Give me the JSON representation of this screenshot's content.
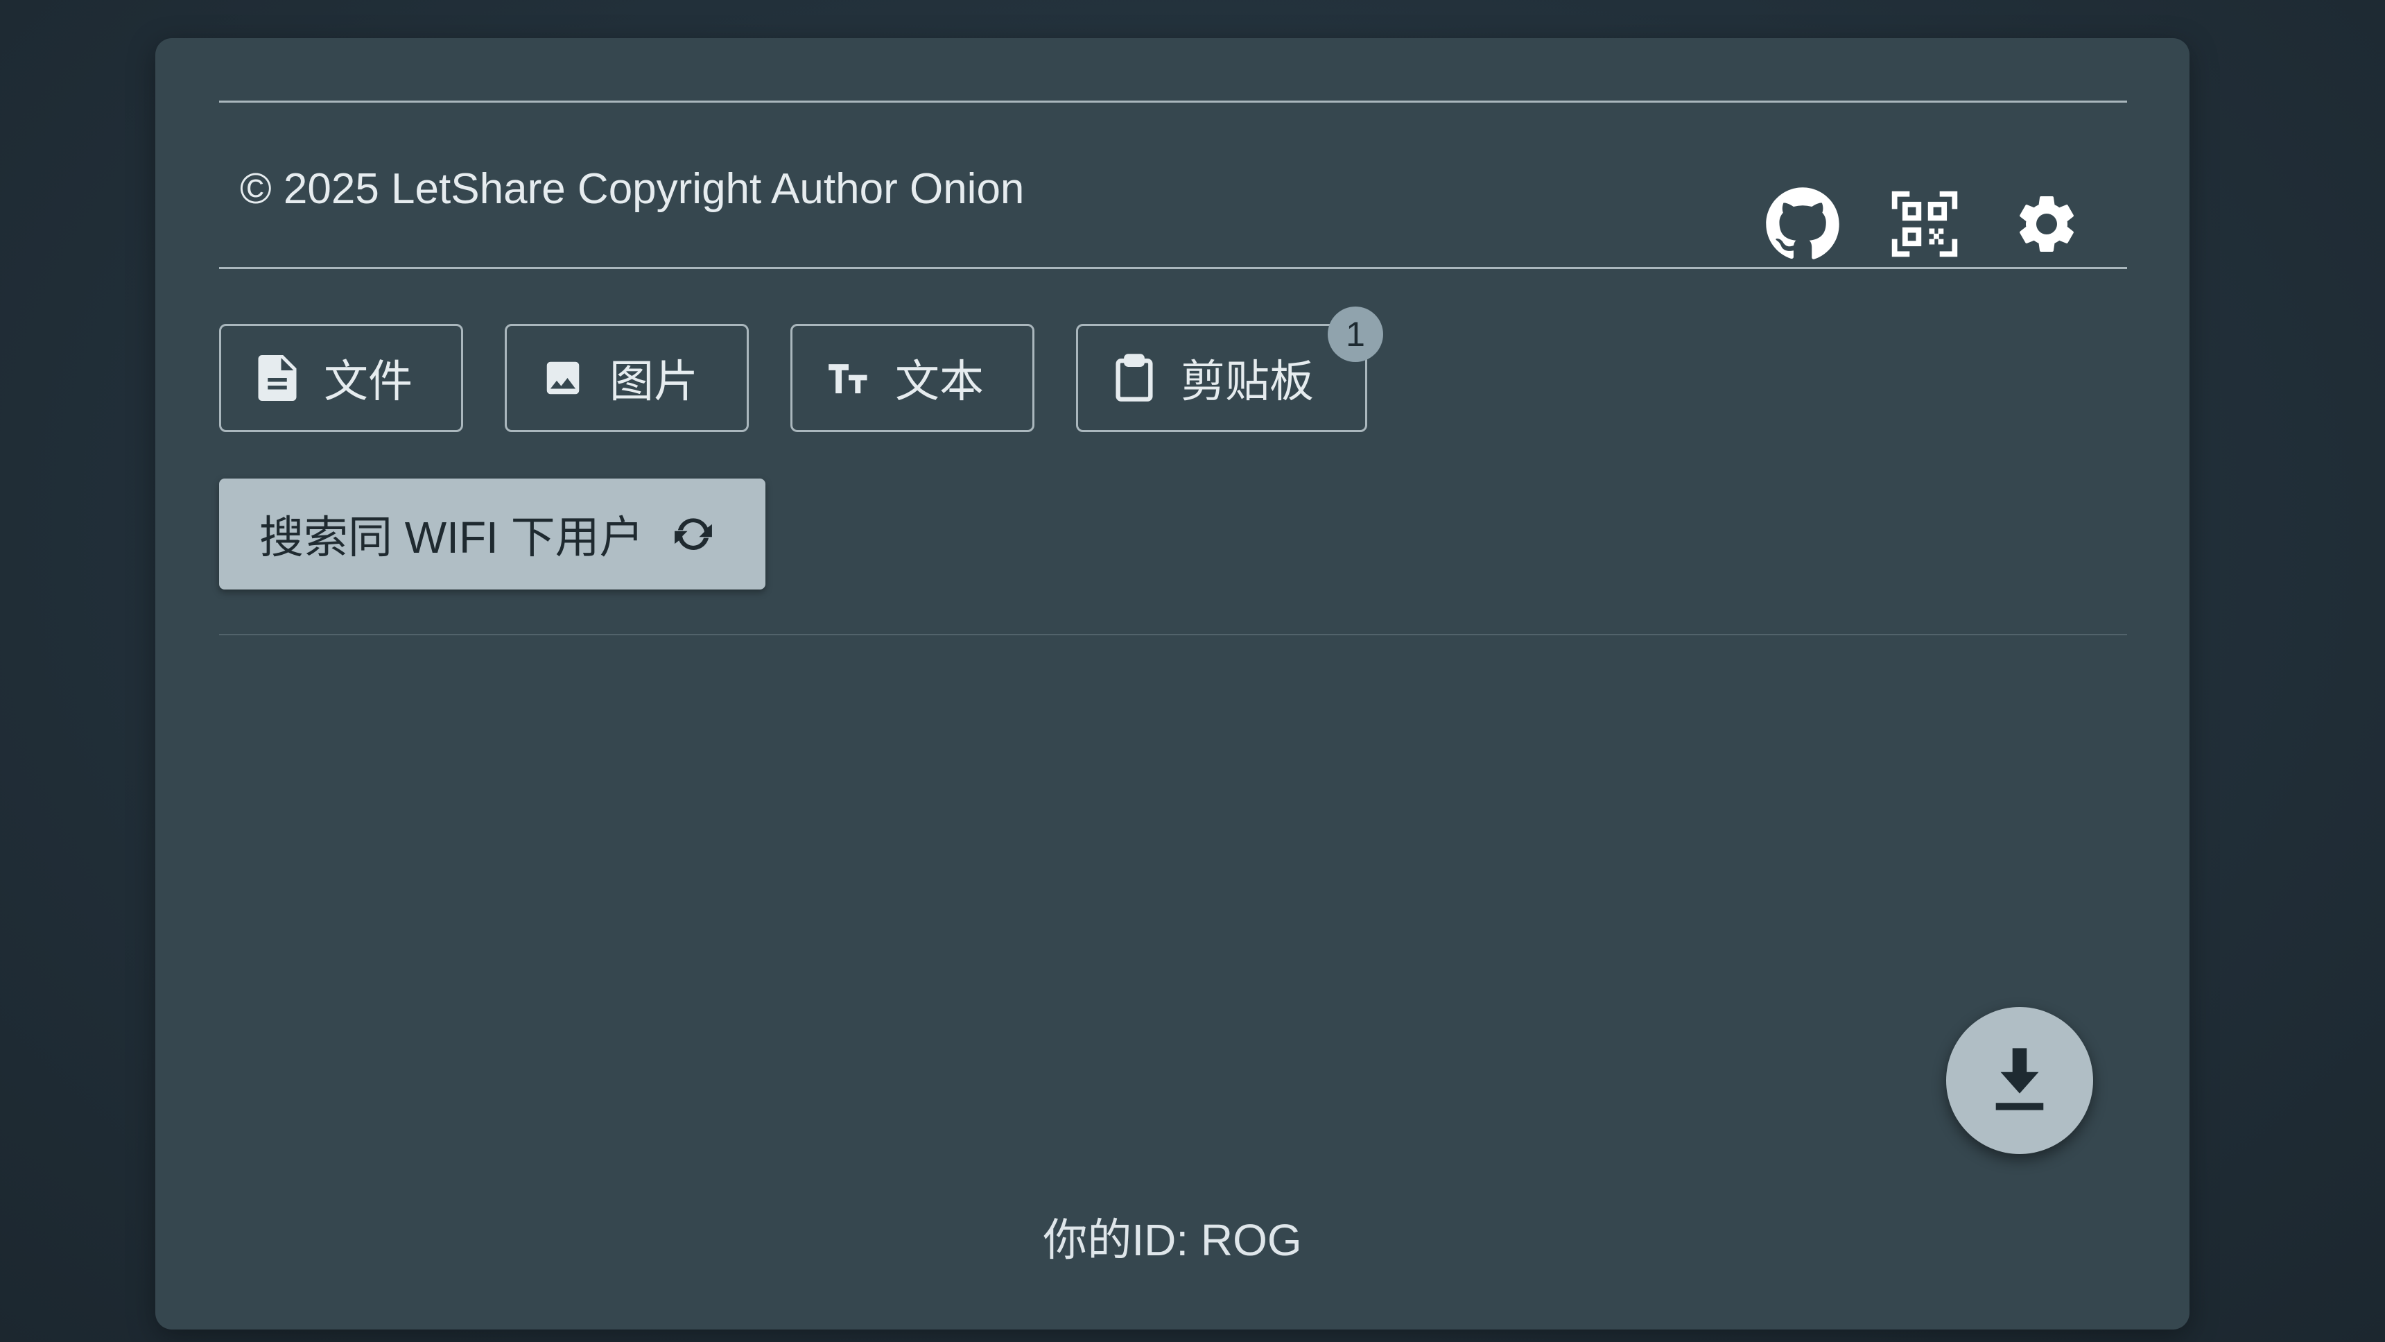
{
  "footer": {
    "copyright": "© 2025 LetShare Copyright Author Onion"
  },
  "header_icons": [
    {
      "name": "github-icon"
    },
    {
      "name": "qr-code-icon"
    },
    {
      "name": "settings-icon"
    }
  ],
  "tabs": [
    {
      "label": "文件",
      "icon": "file-icon"
    },
    {
      "label": "图片",
      "icon": "image-icon"
    },
    {
      "label": "文本",
      "icon": "text-icon"
    },
    {
      "label": "剪贴板",
      "icon": "clipboard-icon",
      "badge": "1"
    }
  ],
  "search": {
    "label": "搜索同 WIFI 下用户",
    "icon": "refresh-icon"
  },
  "fab": {
    "icon": "download-icon"
  },
  "identity": {
    "label": "你的ID: ROG"
  },
  "colors": {
    "background": "#22303a",
    "card": "#36474f",
    "accent": "#b0bec5",
    "text": "#e6ecef"
  }
}
